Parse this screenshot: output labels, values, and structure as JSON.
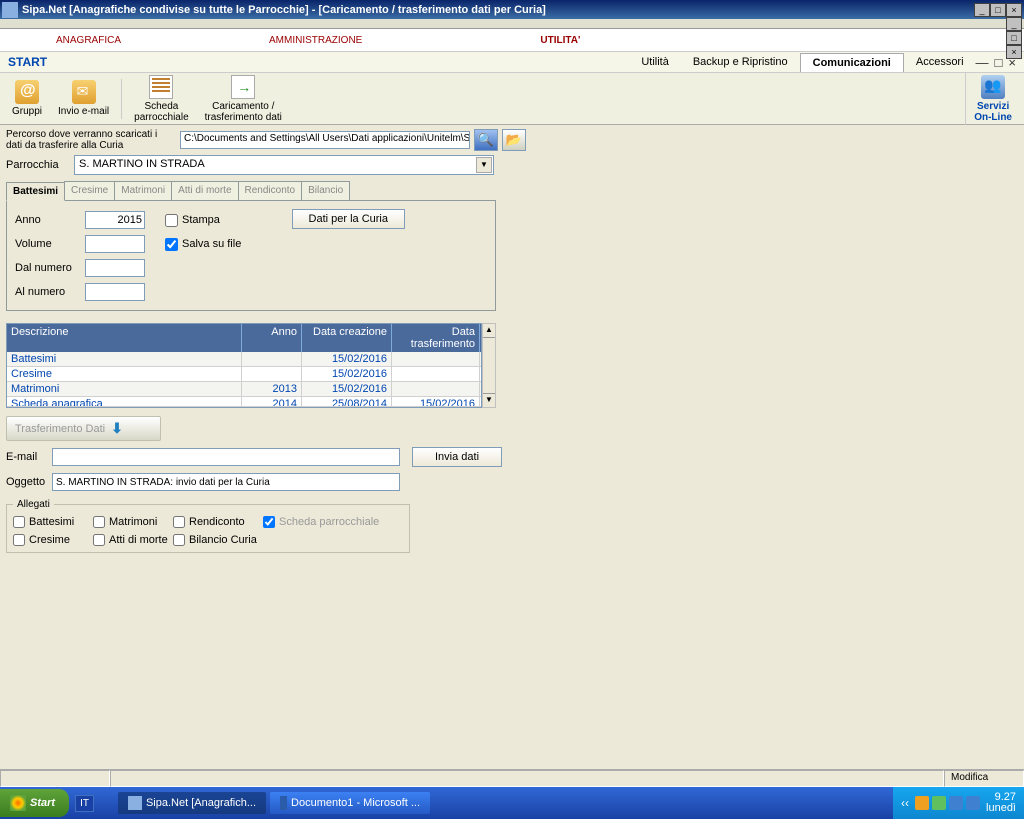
{
  "window": {
    "title": "Sipa.Net  [Anagrafiche condivise su tutte le Parrocchie] - [Caricamento / trasferimento dati per Curia]"
  },
  "menubar": {
    "anagrafica": "ANAGRAFICA",
    "amministrazione": "AMMINISTRAZIONE",
    "utilita": "UTILITA'"
  },
  "startbar": {
    "label": "START",
    "tabs": {
      "utilita": "Utilità",
      "backup": "Backup e Ripristino",
      "comunicazioni": "Comunicazioni",
      "accessori": "Accessori"
    }
  },
  "toolbar": {
    "gruppi": "Gruppi",
    "invio_email": "Invio e-mail",
    "scheda": "Scheda\nparrocchiale",
    "caricamento": "Caricamento /\ntrasferimento dati",
    "servizi": "Servizi\nOn-Line"
  },
  "path": {
    "label": "Percorso dove verranno scaricati i dati da trasferire alla Curia",
    "value": "C:\\Documents and Settings\\All Users\\Dati applicazioni\\Unitelm\\Sipa\\EXP"
  },
  "parrocchia": {
    "label": "Parrocchia",
    "value": "S. MARTINO IN STRADA"
  },
  "tabs": {
    "battesimi": "Battesimi",
    "cresime": "Cresime",
    "matrimoni": "Matrimoni",
    "atti_morte": "Atti di morte",
    "rendiconto": "Rendiconto",
    "bilancio": "Bilancio"
  },
  "form": {
    "anno_label": "Anno",
    "anno_value": "2015",
    "volume_label": "Volume",
    "dal_label": "Dal numero",
    "al_label": "Al numero",
    "stampa": "Stampa",
    "salva": "Salva su file",
    "dati_btn": "Dati per la Curia"
  },
  "grid": {
    "headers": {
      "desc": "Descrizione",
      "anno": "Anno",
      "dc": "Data creazione",
      "dt": "Data trasferimento"
    },
    "rows": [
      {
        "desc": "Battesimi",
        "anno": "",
        "dc": "15/02/2016",
        "dt": ""
      },
      {
        "desc": "Cresime",
        "anno": "",
        "dc": "15/02/2016",
        "dt": ""
      },
      {
        "desc": "Matrimoni",
        "anno": "2013",
        "dc": "15/02/2016",
        "dt": ""
      },
      {
        "desc": "Scheda anagrafica",
        "anno": "2014",
        "dc": "25/08/2014",
        "dt": "15/02/2016"
      }
    ]
  },
  "trasf": {
    "title": "Trasferimento Dati",
    "email_label": "E-mail",
    "email_value": "",
    "oggetto_label": "Oggetto",
    "oggetto_value": "S. MARTINO IN STRADA: invio dati per la Curia",
    "invia_btn": "Invia dati",
    "allegati_legend": "Allegati",
    "chk_battesimi": "Battesimi",
    "chk_matrimoni": "Matrimoni",
    "chk_rendiconto": "Rendiconto",
    "chk_scheda": "Scheda parrocchiale",
    "chk_cresime": "Cresime",
    "chk_atti": "Atti di morte",
    "chk_bilancio": "Bilancio Curia"
  },
  "status": {
    "modifica": "Modifica"
  },
  "taskbar": {
    "start": "Start",
    "lang": "IT",
    "task1": "Sipa.Net  [Anagrafich...",
    "task2": "Documento1 - Microsoft ...",
    "time": "9.27",
    "day": "lunedì"
  }
}
